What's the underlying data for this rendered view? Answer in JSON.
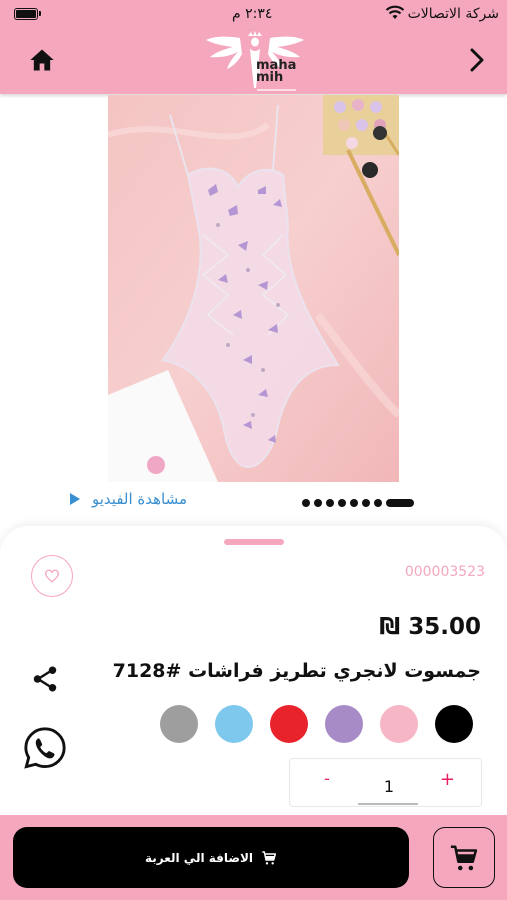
{
  "status_bar": {
    "time": "٢:٣٤ م",
    "carrier": "شركة الاتصالات"
  },
  "header": {
    "logo_text_line1": "maha",
    "logo_text_line2": "mih"
  },
  "gallery": {
    "video_label": "مشاهدة الفيديو",
    "slide_count": 8,
    "active_slide": 8
  },
  "product": {
    "sku": "000003523",
    "price": "35.00 ₪",
    "title": "جمسوت لانجري تطريز فراشات #7128",
    "colors": [
      "#9e9e9e",
      "#7ec8ee",
      "#e8232c",
      "#a78bc6",
      "#f7b6c6",
      "#000000"
    ]
  },
  "quantity": {
    "minus": "-",
    "plus": "+",
    "value": "1"
  },
  "actions": {
    "add_to_cart_label": "الاضافة الي العربة"
  },
  "theme": {
    "brand_pink": "#f4a7bd",
    "link_blue": "#3a8fd0",
    "accent_red": "#e91e63"
  },
  "icons": [
    "battery-icon",
    "wifi-icon",
    "home-icon",
    "chevron-right-icon",
    "play-icon",
    "heart-icon",
    "share-icon",
    "whatsapp-icon",
    "cart-icon"
  ]
}
